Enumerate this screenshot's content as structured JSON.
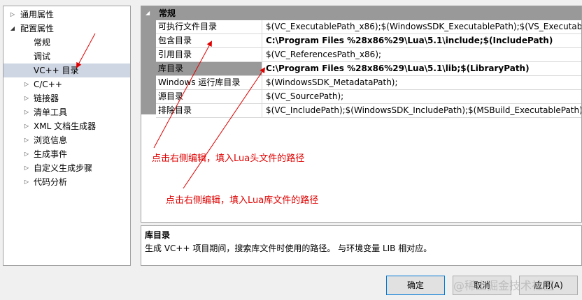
{
  "tree": {
    "items": [
      {
        "label": "通用属性",
        "arrow": "right"
      },
      {
        "label": "配置属性",
        "arrow": "down"
      },
      {
        "label": "常规",
        "arrow": ""
      },
      {
        "label": "调试",
        "arrow": ""
      },
      {
        "label": "VC++ 目录",
        "arrow": "",
        "selected": true
      },
      {
        "label": "C/C++",
        "arrow": "right"
      },
      {
        "label": "链接器",
        "arrow": "right"
      },
      {
        "label": "清单工具",
        "arrow": "right"
      },
      {
        "label": "XML 文档生成器",
        "arrow": "right"
      },
      {
        "label": "浏览信息",
        "arrow": "right"
      },
      {
        "label": "生成事件",
        "arrow": "right"
      },
      {
        "label": "自定义生成步骤",
        "arrow": "right"
      },
      {
        "label": "代码分析",
        "arrow": "right"
      }
    ]
  },
  "grid": {
    "category": "常规",
    "rows": [
      {
        "name": "可执行文件目录",
        "value": "$(VC_ExecutablePath_x86);$(WindowsSDK_ExecutablePath);$(VS_ExecutablePa",
        "bold": false
      },
      {
        "name": "包含目录",
        "value": "C:\\Program Files %28x86%29\\Lua\\5.1\\include;$(IncludePath)",
        "bold": true
      },
      {
        "name": "引用目录",
        "value": "$(VC_ReferencesPath_x86);",
        "bold": false
      },
      {
        "name": "库目录",
        "value": "C:\\Program Files %28x86%29\\Lua\\5.1\\lib;$(LibraryPath)",
        "bold": true,
        "selected": true
      },
      {
        "name": "Windows 运行库目录",
        "value": "$(WindowsSDK_MetadataPath);",
        "bold": false
      },
      {
        "name": "源目录",
        "value": "$(VC_SourcePath);",
        "bold": false
      },
      {
        "name": "排除目录",
        "value": "$(VC_IncludePath);$(WindowsSDK_IncludePath);$(MSBuild_ExecutablePath);$(",
        "bold": false
      }
    ]
  },
  "annotations": {
    "include_note": "点击右侧编辑，填入Lua头文件的路径",
    "lib_note": "点击右侧编辑，填入Lua库文件的路径",
    "color": "#e00000"
  },
  "description": {
    "title": "库目录",
    "text": "生成 VC++ 项目期间，搜索库文件时使用的路径。 与环境变量 LIB 相对应。"
  },
  "buttons": {
    "ok": "确定",
    "cancel": "取消",
    "apply": "应用(A)"
  },
  "watermark": "@稀土掘金技术社区"
}
